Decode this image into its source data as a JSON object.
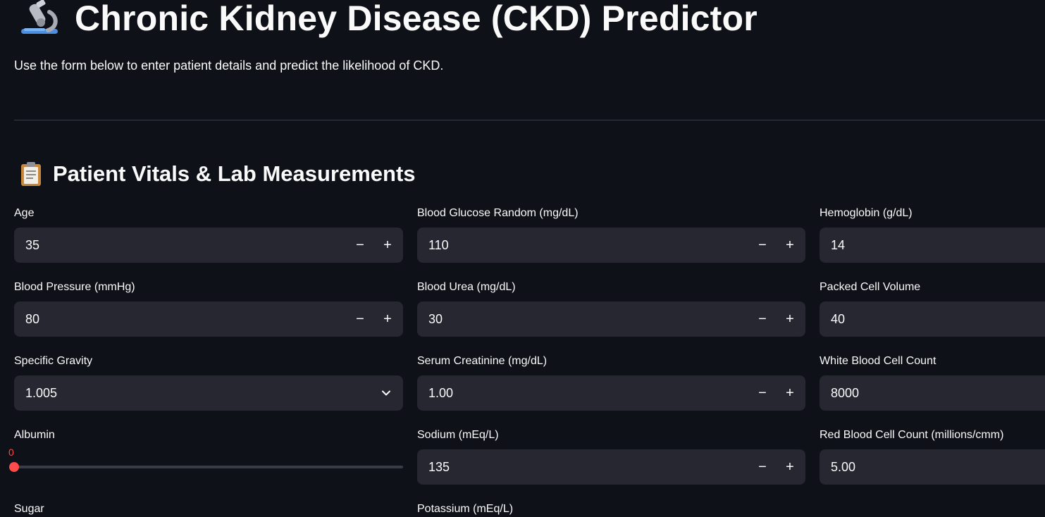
{
  "header": {
    "title": "Chronic Kidney Disease (CKD) Predictor",
    "subtitle": "Use the form below to enter patient details and predict the likelihood of CKD.",
    "title_icon": "microscope-icon"
  },
  "section": {
    "title": "Patient Vitals & Lab Measurements",
    "icon": "clipboard-icon"
  },
  "controls": {
    "minus": "−",
    "plus": "+"
  },
  "fields": {
    "age": {
      "label": "Age",
      "value": "35"
    },
    "blood_pressure": {
      "label": "Blood Pressure (mmHg)",
      "value": "80"
    },
    "specific_gravity": {
      "label": "Specific Gravity",
      "value": "1.005"
    },
    "albumin": {
      "label": "Albumin",
      "value": "0"
    },
    "sugar": {
      "label": "Sugar"
    },
    "blood_glucose_random": {
      "label": "Blood Glucose Random (mg/dL)",
      "value": "110"
    },
    "blood_urea": {
      "label": "Blood Urea (mg/dL)",
      "value": "30"
    },
    "serum_creatinine": {
      "label": "Serum Creatinine (mg/dL)",
      "value": "1.00"
    },
    "sodium": {
      "label": "Sodium (mEq/L)",
      "value": "135"
    },
    "potassium": {
      "label": "Potassium (mEq/L)"
    },
    "hemoglobin": {
      "label": "Hemoglobin (g/dL)",
      "value": "14"
    },
    "packed_cell_volume": {
      "label": "Packed Cell Volume",
      "value": "40"
    },
    "white_blood_cell_count": {
      "label": "White Blood Cell Count",
      "value": "8000"
    },
    "red_blood_cell_count": {
      "label": "Red Blood Cell Count (millions/cmm)",
      "value": "5.00"
    }
  },
  "colors": {
    "background": "#0e1117",
    "input_background": "#262730",
    "accent": "#ff4b4b"
  }
}
